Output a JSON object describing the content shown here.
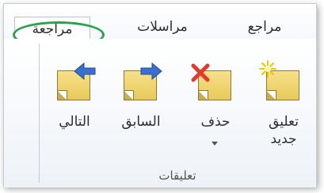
{
  "tabs": {
    "review": "مراجعة",
    "mailings": "مراسلات",
    "references": "مراجع"
  },
  "comments_group": {
    "title": "تعليقات",
    "new_comment_line1": "تعليق",
    "new_comment_line2": "جديد",
    "delete": "حذف",
    "previous": "السابق",
    "next": "التالي"
  },
  "colors": {
    "highlight": "#2aa24a",
    "arrow": "#3b6fce",
    "delete_x": "#e23a2e",
    "sparkle": "#f2c400"
  },
  "icons": {
    "new_comment": "new-comment-sparkle",
    "delete": "delete-x",
    "previous": "arrow-right",
    "next": "arrow-left"
  }
}
